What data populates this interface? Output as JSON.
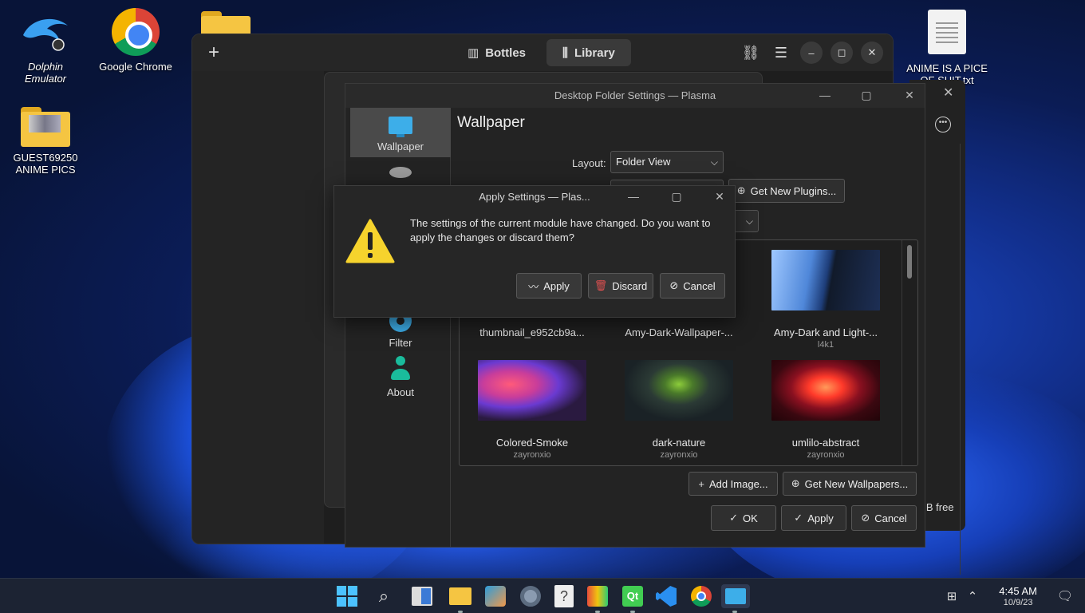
{
  "desktop": {
    "icons": [
      {
        "line1": "Dolphin",
        "line2": "Emulator"
      },
      {
        "line1": "Google Chrome",
        "line2": ""
      },
      {
        "line1": "GUEST69250",
        "line2": "ANIME PICS"
      },
      {
        "line1": "ANIME IS A PICE",
        "line2": "OF SHIT.txt"
      }
    ]
  },
  "bottles": {
    "tabs": [
      {
        "label": "Bottles"
      },
      {
        "label": "Library"
      }
    ],
    "active_tab": "Library"
  },
  "behind_panel": {
    "free_text": "iB free"
  },
  "settings": {
    "title": "Desktop Folder Settings — Plasma",
    "nav": [
      {
        "label": "Wallpaper"
      },
      {
        "label": "Filter"
      },
      {
        "label": "About"
      }
    ],
    "page_title": "Wallpaper",
    "layout_label": "Layout:",
    "layout_value": "Folder View",
    "get_plugins": "Get New Plugins...",
    "wallpapers": [
      {
        "name": "thumbnail_e952cb9a...",
        "author": ""
      },
      {
        "name": "Amy-Dark-Wallpaper-...",
        "author": ""
      },
      {
        "name": "Amy-Dark and Light-...",
        "author": "l4k1"
      },
      {
        "name": "Colored-Smoke",
        "author": "zayronxio"
      },
      {
        "name": "dark-nature",
        "author": "zayronxio"
      },
      {
        "name": "umlilo-abstract",
        "author": "zayronxio"
      }
    ],
    "add_image": "Add Image...",
    "get_wallpapers": "Get New Wallpapers...",
    "ok": "OK",
    "apply": "Apply",
    "cancel": "Cancel"
  },
  "dialog": {
    "title": "Apply Settings — Plas...",
    "message": "The settings of the current module have changed. Do you want to apply the changes or discard them?",
    "apply": "Apply",
    "discard": "Discard",
    "cancel": "Cancel"
  },
  "taskbar": {
    "time": "4:45 AM",
    "date": "10/9/23"
  },
  "colors": {
    "accent": "#3daee9",
    "start": "#4cc2ff",
    "warning": "#f6d32d"
  }
}
